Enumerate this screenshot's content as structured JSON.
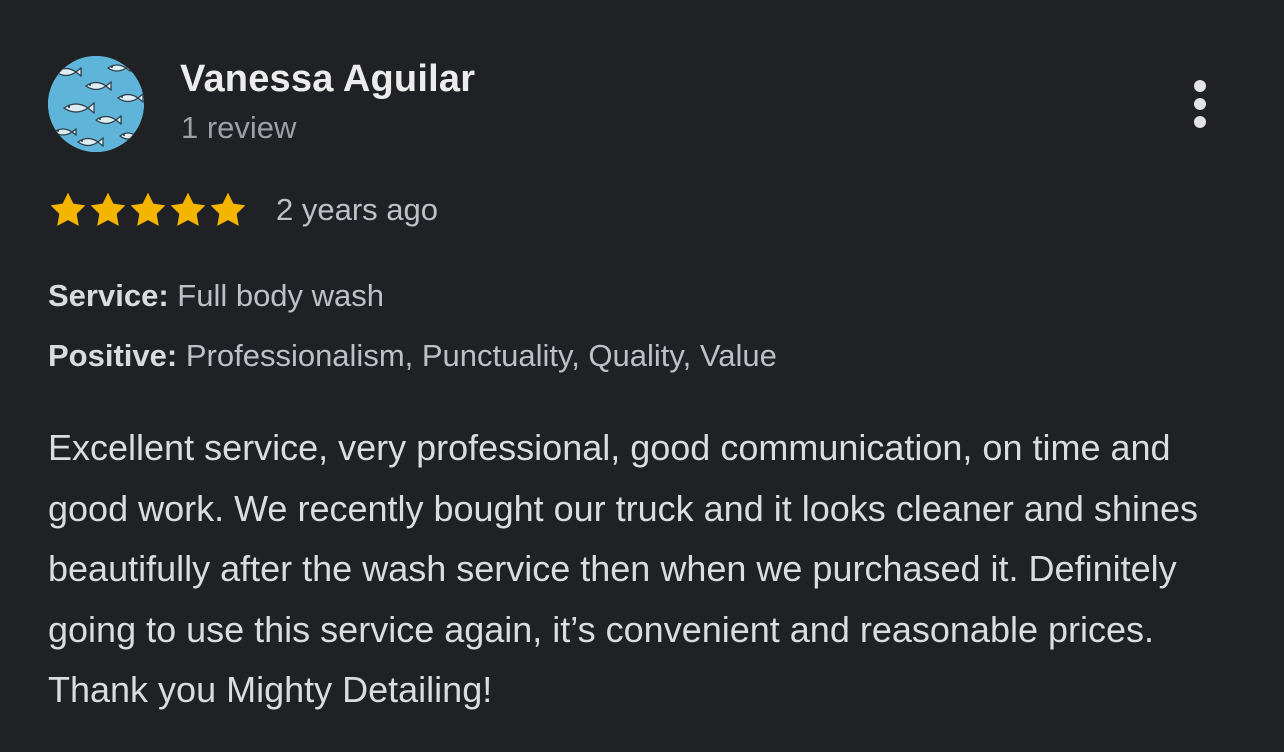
{
  "reviewer": {
    "name": "Vanessa Aguilar",
    "review_count": "1 review",
    "avatar_icon": "fish-pattern-avatar"
  },
  "menu": {
    "icon": "more-vertical-icon"
  },
  "rating": {
    "stars": 5,
    "max_stars": 5,
    "star_color": "#f4b400",
    "date": "2 years ago"
  },
  "attributes": {
    "service_label": "Service:",
    "service_value": "Full body wash",
    "positive_label": "Positive:",
    "positive_value": "Professionalism, Punctuality, Quality, Value"
  },
  "review_text": "Excellent service, very professional, good communication, on time and good work. We recently bought our truck and it looks cleaner and shines beautifully after the wash service then when we purchased it. Definitely going to use this service again, it’s convenient and reasonable prices. Thank you Mighty Detailing!",
  "colors": {
    "background": "#202124",
    "avatar_background": "#5fb4d9"
  }
}
